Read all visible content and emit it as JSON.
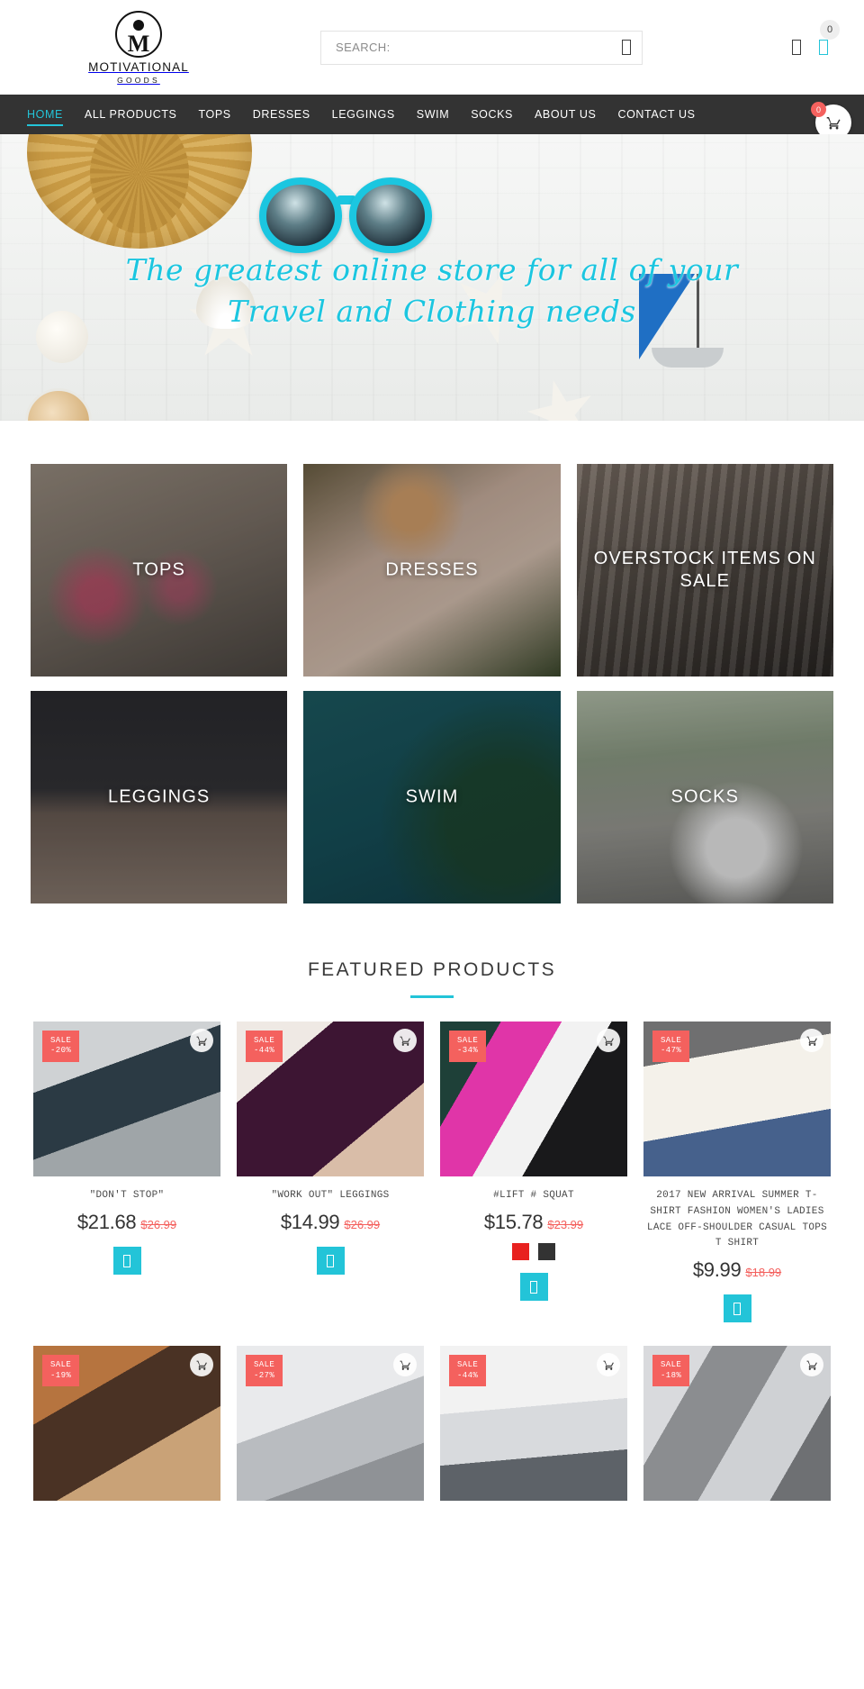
{
  "brand": {
    "name": "MOTIVATIONAL",
    "sub": "GOODS",
    "mark_letter": "M"
  },
  "search": {
    "placeholder": "SEARCH:",
    "value": "",
    "icon": "search-icon"
  },
  "header_icons": {
    "account_icon": "user-icon",
    "cart_icon": "cart-icon",
    "cart_count": "0"
  },
  "nav": {
    "items": [
      {
        "label": "HOME",
        "active": true
      },
      {
        "label": "ALL PRODUCTS",
        "active": false
      },
      {
        "label": "TOPS",
        "active": false
      },
      {
        "label": "DRESSES",
        "active": false
      },
      {
        "label": "LEGGINGS",
        "active": false
      },
      {
        "label": "SWIM",
        "active": false
      },
      {
        "label": "SOCKS",
        "active": false
      },
      {
        "label": "ABOUT US",
        "active": false
      },
      {
        "label": "CONTACT US",
        "active": false
      }
    ],
    "cart_fab_count": "0",
    "cart_fab_icon": "shopping-cart-icon"
  },
  "hero": {
    "line1": "The greatest online store for all of your",
    "line2": "Travel and Clothing needs",
    "accent_color": "#1bc6e0"
  },
  "categories": [
    {
      "label": "TOPS",
      "img": "img-tops"
    },
    {
      "label": "DRESSES",
      "img": "img-dresses"
    },
    {
      "label": "OVERSTOCK ITEMS ON SALE",
      "img": "img-overstock"
    },
    {
      "label": "LEGGINGS",
      "img": "img-leggings"
    },
    {
      "label": "SWIM",
      "img": "img-swim"
    },
    {
      "label": "SOCKS",
      "img": "img-socks"
    }
  ],
  "featured": {
    "title": "FEATURED PRODUCTS",
    "accent_color": "#23c4d8",
    "sale_label": "SALE",
    "products": [
      {
        "title": "\"DON'T STOP\"",
        "price": "$21.68",
        "old_price": "$26.99",
        "sale": "SALE",
        "discount": "-20%",
        "img": "pi-1",
        "swatches": [],
        "add_button": true
      },
      {
        "title": "\"WORK OUT\" LEGGINGS",
        "price": "$14.99",
        "old_price": "$26.99",
        "sale": "SALE",
        "discount": "-44%",
        "img": "pi-2",
        "swatches": [],
        "add_button": true
      },
      {
        "title": "#LIFT # SQUAT",
        "price": "$15.78",
        "old_price": "$23.99",
        "sale": "SALE",
        "discount": "-34%",
        "img": "pi-3",
        "swatches": [
          "#e8211f",
          "#333333"
        ],
        "add_button": true
      },
      {
        "title": "2017 NEW ARRIVAL SUMMER T-SHIRT FASHION WOMEN'S LADIES LACE OFF-SHOULDER CASUAL TOPS T SHIRT",
        "price": "$9.99",
        "old_price": "$18.99",
        "sale": "SALE",
        "discount": "-47%",
        "img": "pi-4",
        "swatches": [],
        "add_button": true
      },
      {
        "title": "",
        "price": "",
        "old_price": "",
        "sale": "SALE",
        "discount": "-19%",
        "img": "pi-5",
        "swatches": [],
        "add_button": false
      },
      {
        "title": "",
        "price": "",
        "old_price": "",
        "sale": "SALE",
        "discount": "-27%",
        "img": "pi-6",
        "swatches": [],
        "add_button": false
      },
      {
        "title": "",
        "price": "",
        "old_price": "",
        "sale": "SALE",
        "discount": "-44%",
        "img": "pi-7",
        "swatches": [],
        "add_button": false
      },
      {
        "title": "",
        "price": "",
        "old_price": "",
        "sale": "SALE",
        "discount": "-18%",
        "img": "pi-8",
        "swatches": [],
        "add_button": false
      }
    ]
  }
}
